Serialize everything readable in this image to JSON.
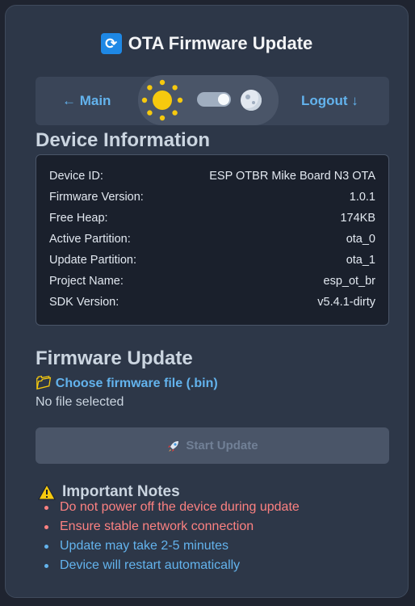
{
  "header": {
    "title": "OTA Firmware Update",
    "icon": "refresh-icon"
  },
  "nav": {
    "main_label": "← Main",
    "logout_label": "Logout ↓",
    "theme_toggle": {
      "mode": "light",
      "icons": [
        "sun-icon",
        "moon-icon"
      ]
    }
  },
  "device_info": {
    "heading": "Device Information",
    "rows": [
      {
        "label": "Device ID:",
        "value": "ESP OTBR Mike Board N3 OTA"
      },
      {
        "label": "Firmware Version:",
        "value": "1.0.1"
      },
      {
        "label": "Free Heap:",
        "value": "174KB"
      },
      {
        "label": "Active Partition:",
        "value": "ota_0"
      },
      {
        "label": "Update Partition:",
        "value": "ota_1"
      },
      {
        "label": "Project Name:",
        "value": "esp_ot_br"
      },
      {
        "label": "SDK Version:",
        "value": "v5.4.1-dirty"
      }
    ]
  },
  "firmware_update": {
    "heading": "Firmware Update",
    "choose_label": "Choose firmware file (.bin)",
    "file_status": "No file selected",
    "start_button": "Start Update"
  },
  "notes": {
    "heading": "Important Notes",
    "items": [
      {
        "text": "Do not power off the device during update",
        "color": "#fc8181"
      },
      {
        "text": "Ensure stable network connection",
        "color": "#fc8181"
      },
      {
        "text": "Update may take 2-5 minutes",
        "color": "#63b3ed"
      },
      {
        "text": "Device will restart automatically",
        "color": "#63b3ed"
      }
    ]
  }
}
